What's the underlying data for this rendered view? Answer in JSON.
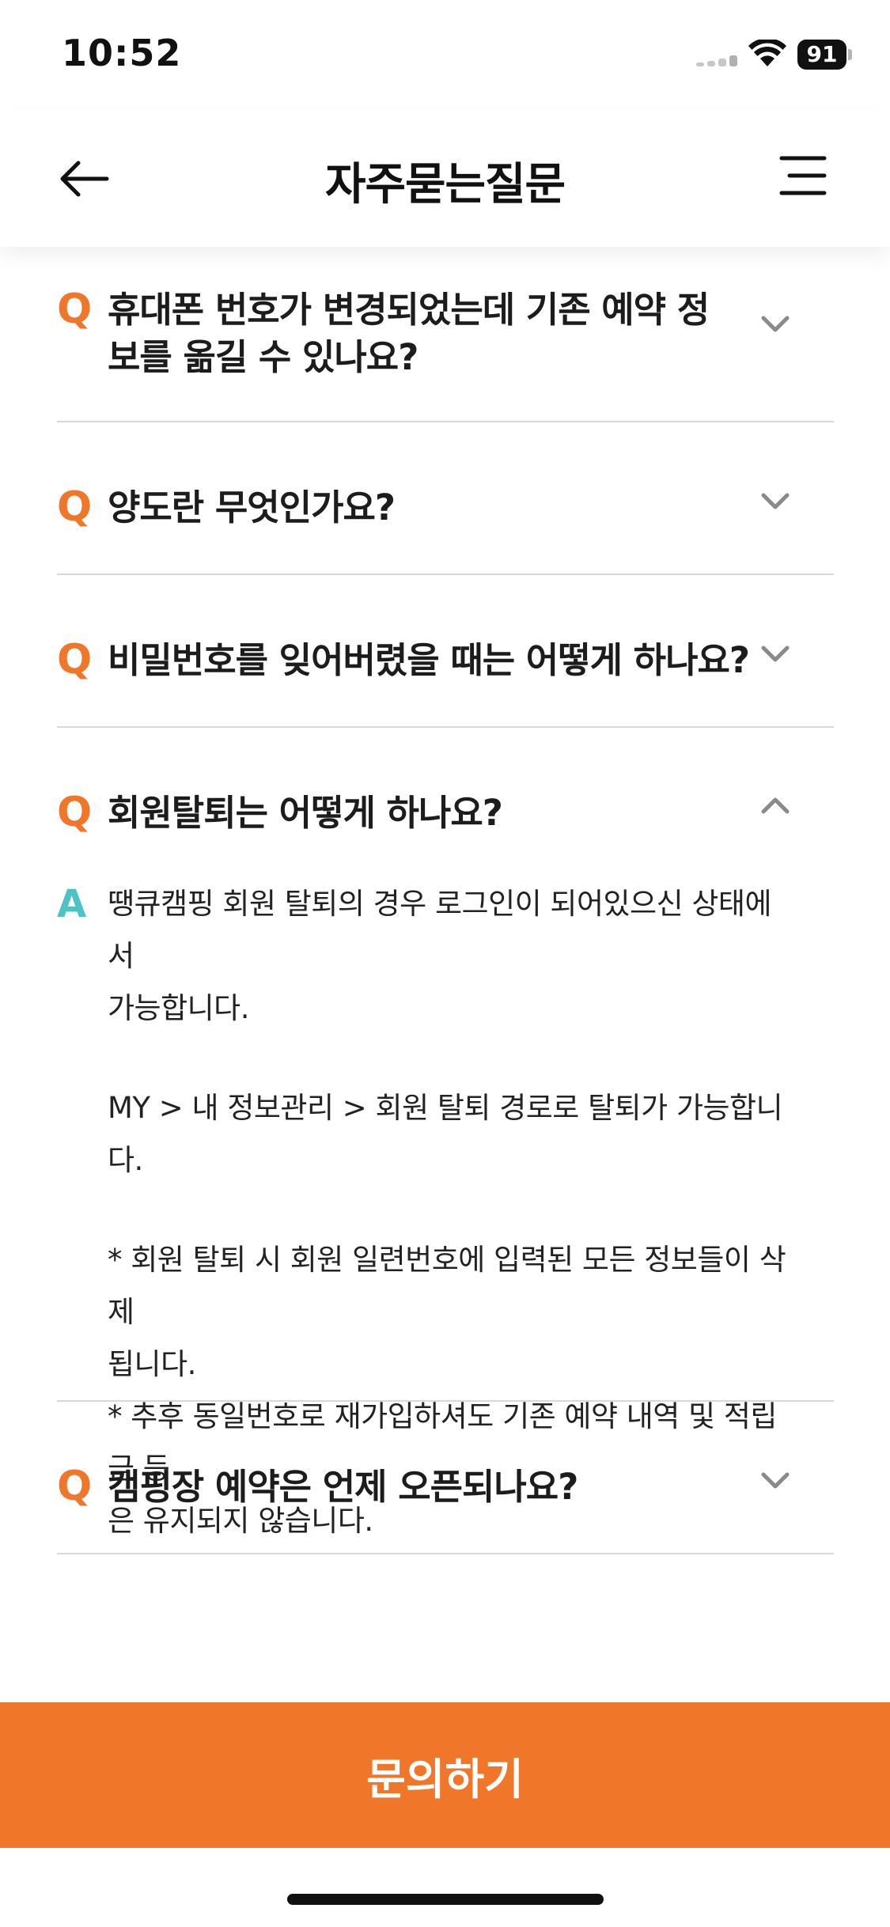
{
  "status_bar": {
    "time": "10:52",
    "battery": "91"
  },
  "header": {
    "title": "자주묻는질문"
  },
  "faq": {
    "items": [
      {
        "q_mark": "Q",
        "question": "휴대폰 번호가 변경되었는데 기존 예약 정보를 옮길 수 있나요?",
        "expanded": false
      },
      {
        "q_mark": "Q",
        "question": "양도란 무엇인가요?",
        "expanded": false
      },
      {
        "q_mark": "Q",
        "question": "비밀번호를 잊어버렸을 때는 어떻게 하나요?",
        "expanded": false
      },
      {
        "q_mark": "Q",
        "question": "회원탈퇴는 어떻게 하나요?",
        "expanded": true,
        "a_mark": "A",
        "answer": {
          "line1": "땡큐캠핑 회원 탈퇴의 경우 로그인이 되어있으신 상태에서",
          "line2": "가능합니다.",
          "line3": "MY > 내 정보관리 > 회원 탈퇴 경로로 탈퇴가 가능합니다.",
          "line4": "* 회원 탈퇴 시 회원 일련번호에 입력된 모든 정보들이 삭제",
          "line5": "됩니다.",
          "line6": "* 추후 동일번호로 재가입하셔도 기존 예약 내역 및 적립금 등",
          "line7": "은 유지되지 않습니다."
        }
      },
      {
        "q_mark": "Q",
        "question": "캠핑장 예약은 언제 오픈되나요?",
        "expanded": false
      }
    ]
  },
  "bottom": {
    "inquiry_label": "문의하기"
  },
  "colors": {
    "accent": "#f0762a",
    "answer_mark": "#4ec3c6",
    "divider": "#d9d9d9"
  }
}
